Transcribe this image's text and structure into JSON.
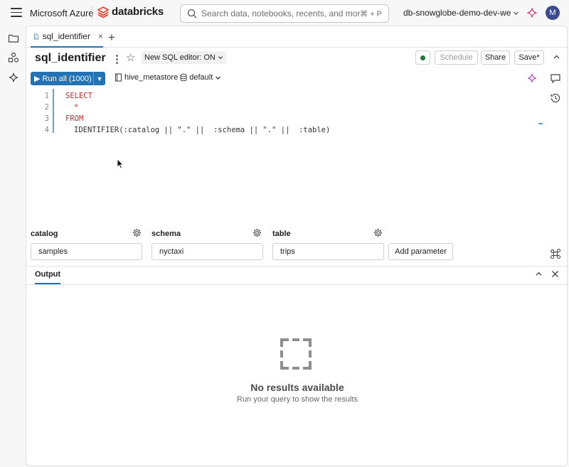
{
  "topbar": {
    "azure_label": "Microsoft Azure",
    "databricks_label": "databricks",
    "search_placeholder": "Search data, notebooks, recents, and more...",
    "search_shortcut": "⌘ + P",
    "workspace_name": "db-snowglobe-demo-dev-we",
    "avatar_initial": "M"
  },
  "tabs": [
    {
      "label": "sql_identifier",
      "close": "×"
    }
  ],
  "tab_add": "+",
  "notebook": {
    "title": "sql_identifier",
    "kebab": "⋮",
    "star": "☆",
    "sql_editor_toggle": "New SQL editor: ON",
    "schedule_label": "Schedule",
    "share_label": "Share",
    "save_label": "Save*",
    "status_color": "#1f7a3d"
  },
  "toolbar": {
    "run_all_label": "Run all",
    "run_all_count": "(1000)",
    "catalog": "hive_metastore",
    "schema": "default"
  },
  "editor": {
    "lines": [
      {
        "number": "1",
        "text": "SELECT"
      },
      {
        "number": "2",
        "text": "*"
      },
      {
        "number": "3",
        "text": "FROM"
      },
      {
        "number": "4",
        "text": "IDENTIFIER(:catalog || \".\" ||  :schema || \".\" ||  :table)"
      }
    ]
  },
  "parameters": [
    {
      "name": "catalog",
      "value": "samples"
    },
    {
      "name": "schema",
      "value": "nyctaxi"
    },
    {
      "name": "table",
      "value": "trips"
    }
  ],
  "add_parameter_label": "Add parameter",
  "output": {
    "tab_label": "Output",
    "empty_title": "No results available",
    "empty_subtitle": "Run your query to show the results"
  },
  "colors": {
    "accent": "#2272b4",
    "keyword": "#c82f2f",
    "brand": "#ff3621"
  }
}
